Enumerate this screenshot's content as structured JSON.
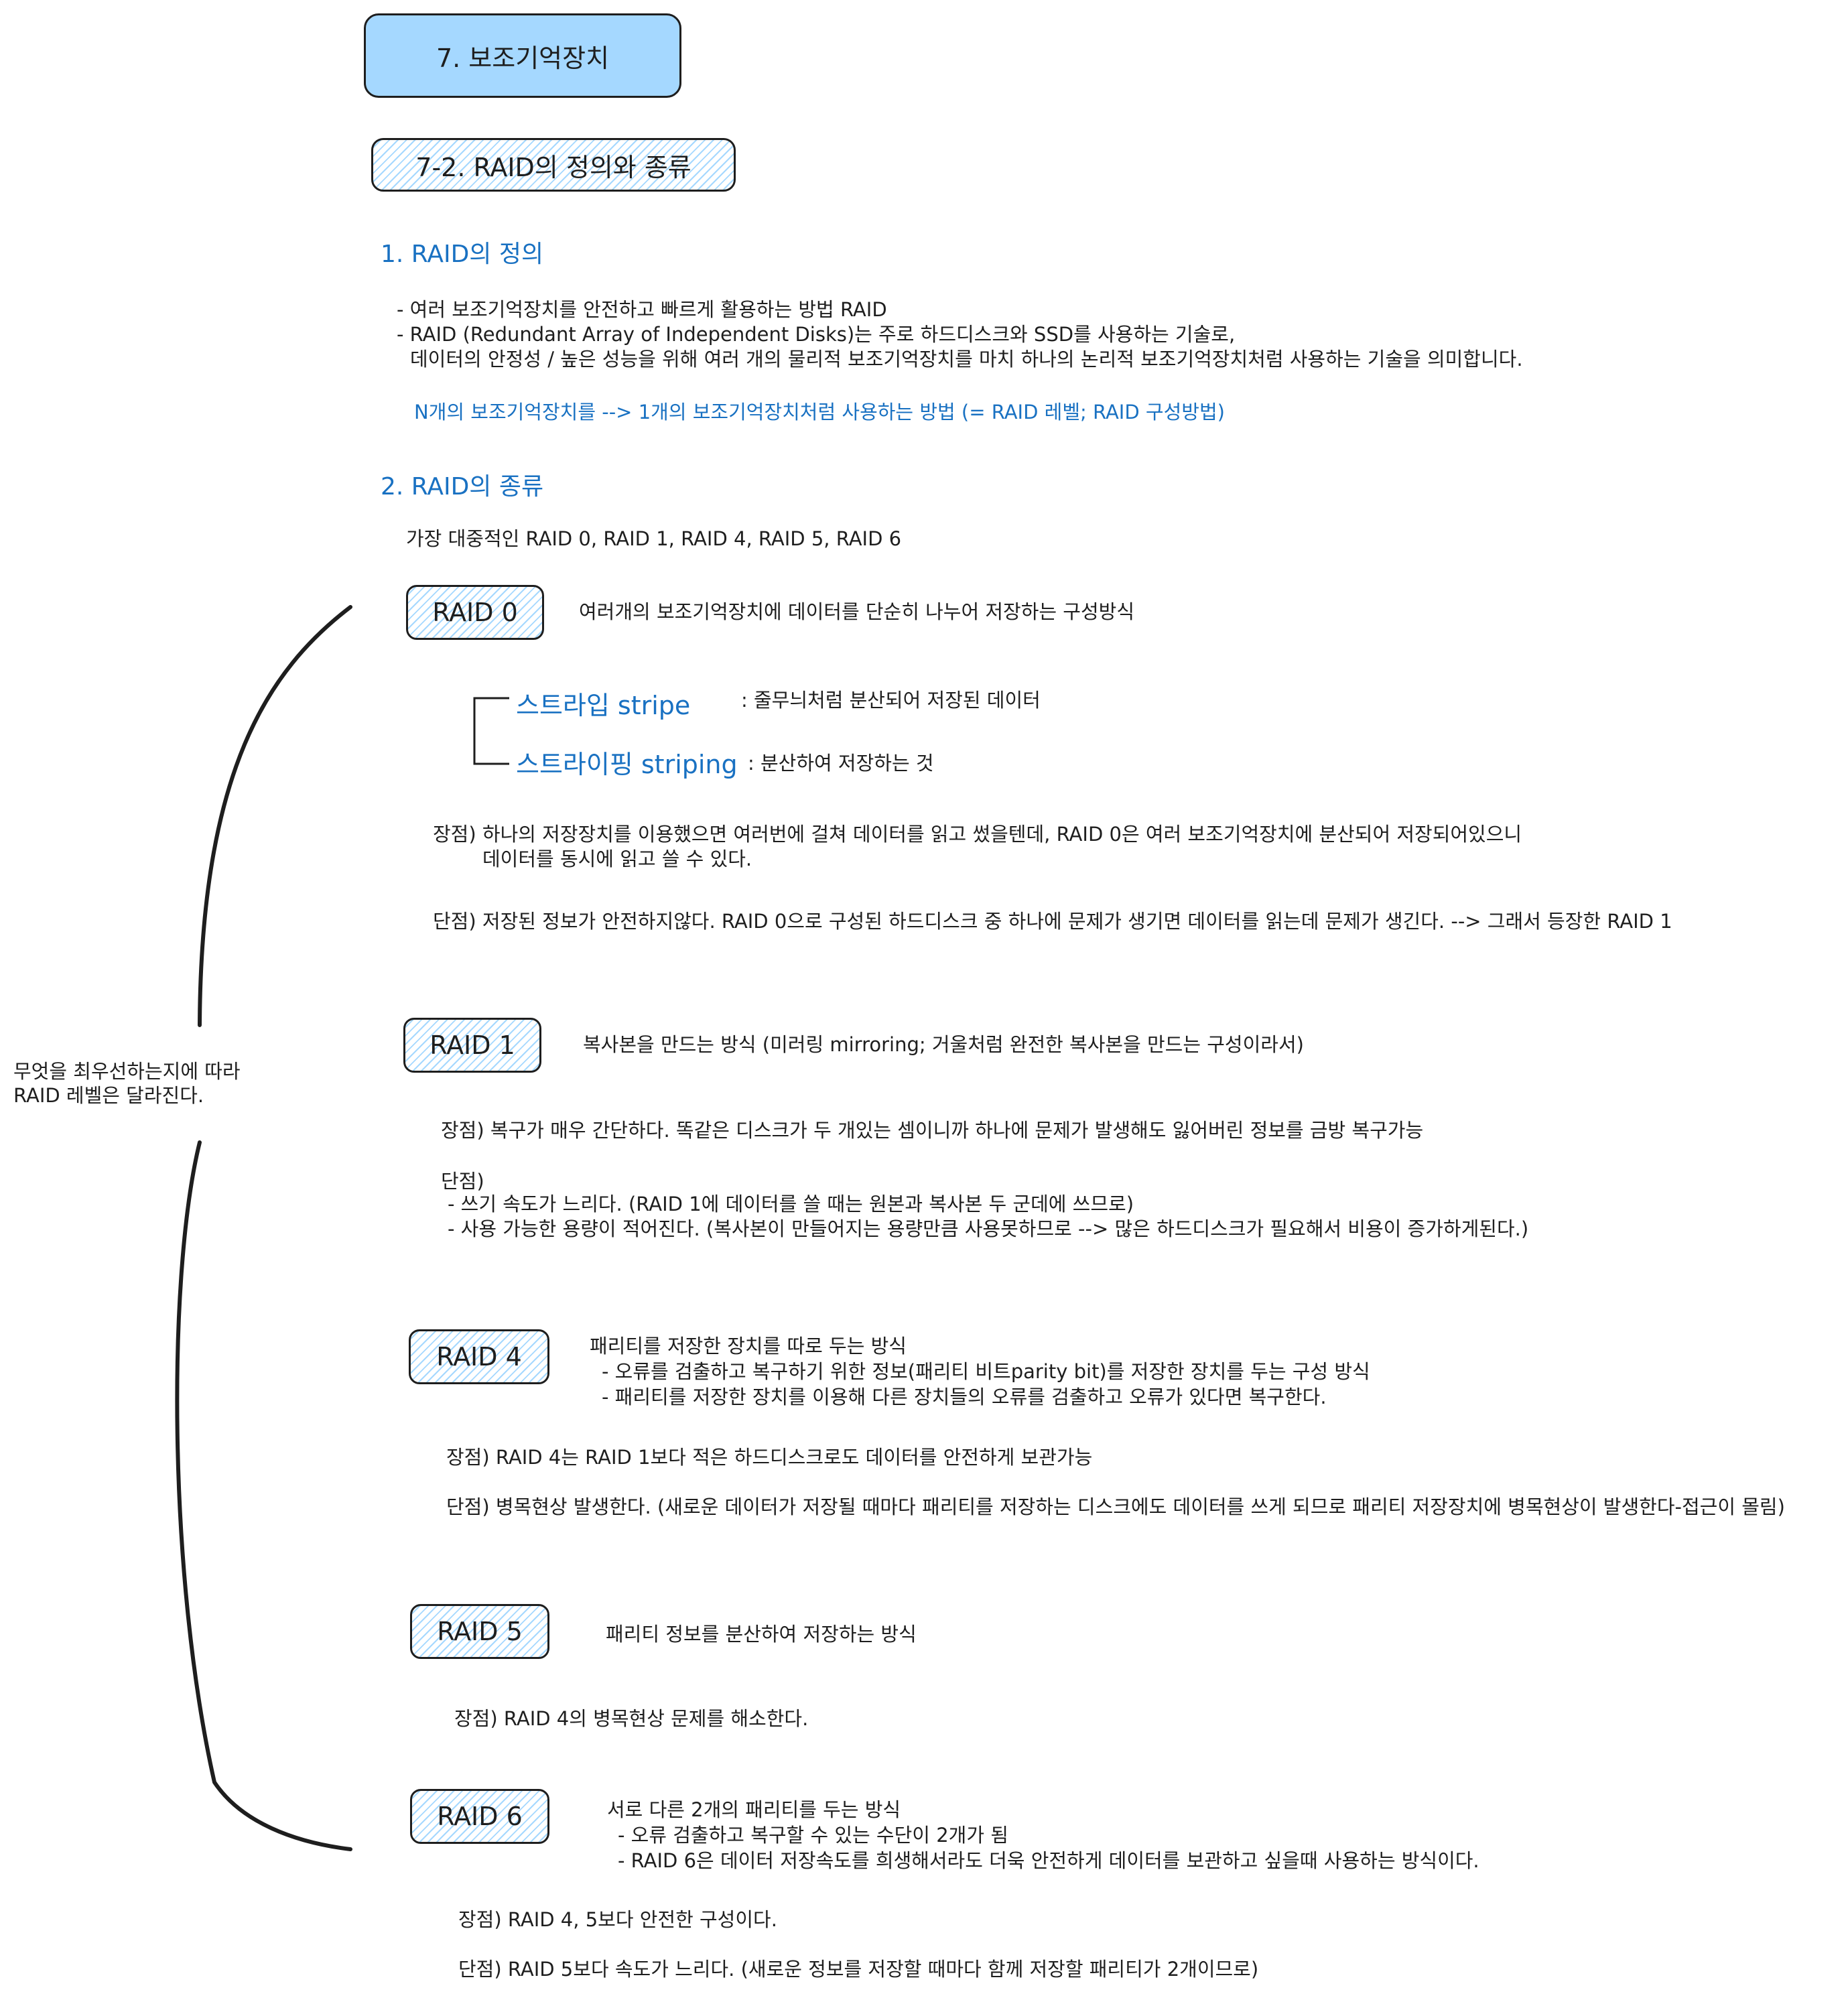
{
  "title": "7. 보조기억장치",
  "subtitle": "7-2. RAID의 정의와 종류",
  "section1": {
    "heading": "1. RAID의 정의",
    "lines": [
      "- 여러 보조기억장치를 안전하고 빠르게 활용하는 방법 RAID",
      "- RAID (Redundant Array of Independent Disks)는 주로 하드디스크와 SSD를 사용하는 기술로,",
      "데이터의 안정성 / 높은 성능을 위해 여러 개의 물리적 보조기억장치를 마치 하나의 논리적 보조기억장치처럼 사용하는 기술을 의미합니다."
    ],
    "summary": "N개의 보조기억장치를 --> 1개의 보조기억장치처럼 사용하는 방법  (= RAID 레벨; RAID 구성방법)"
  },
  "section2": {
    "heading": "2. RAID의 종류",
    "intro": "가장 대중적인 RAID 0, RAID 1, RAID 4, RAID 5, RAID 6"
  },
  "side_note": [
    "무엇을 최우선하는지에 따라",
    "RAID 레벨은 달라진다."
  ],
  "raid0": {
    "label": "RAID 0",
    "desc": "여러개의 보조기억장치에 데이터를 단순히 나누어 저장하는 구성방식",
    "stripe": "스트라입 stripe",
    "stripe_desc": ": 줄무늬처럼 분산되어 저장된 데이터",
    "striping": "스트라이핑 striping",
    "striping_desc": ": 분산하여 저장하는 것",
    "pro1": "장점) 하나의 저장장치를 이용했으면 여러번에 걸쳐 데이터를 읽고 썼을텐데, RAID 0은 여러 보조기억장치에 분산되어 저장되어있으니",
    "pro2": "데이터를 동시에 읽고 쓸 수 있다.",
    "con": "단점) 저장된 정보가 안전하지않다. RAID 0으로 구성된 하드디스크 중 하나에 문제가 생기면 데이터를 읽는데 문제가 생긴다. --> 그래서 등장한 RAID 1"
  },
  "raid1": {
    "label": "RAID 1",
    "desc": "복사본을 만드는 방식 (미러링 mirroring; 거울처럼 완전한 복사본을 만드는 구성이라서)",
    "pro": "장점) 복구가 매우 간단하다. 똑같은 디스크가 두 개있는 셈이니까 하나에 문제가 발생해도 잃어버린 정보를 금방 복구가능",
    "con_title": "단점)",
    "con1": "- 쓰기 속도가 느리다. (RAID 1에 데이터를 쓸 때는 원본과 복사본 두 군데에 쓰므로)",
    "con2": "- 사용 가능한 용량이 적어진다. (복사본이 만들어지는 용량만큼 사용못하므로 --> 많은 하드디스크가 필요해서 비용이 증가하게된다.)"
  },
  "raid4": {
    "label": "RAID 4",
    "desc": "패리티를 저장한 장치를 따로 두는 방식",
    "desc1": "- 오류를 검출하고 복구하기 위한 정보(패리티 비트parity bit)를 저장한 장치를 두는 구성 방식",
    "desc2": "- 패리티를 저장한 장치를 이용해 다른 장치들의 오류를 검출하고 오류가 있다면 복구한다.",
    "pro": "장점) RAID 4는 RAID 1보다 적은 하드디스크로도 데이터를 안전하게 보관가능",
    "con": "단점) 병목현상 발생한다. (새로운 데이터가 저장될 때마다 패리티를 저장하는 디스크에도 데이터를 쓰게 되므로 패리티 저장장치에 병목현상이 발생한다-접근이 몰림)"
  },
  "raid5": {
    "label": "RAID 5",
    "desc": "패리티 정보를 분산하여 저장하는 방식",
    "pro": "장점) RAID 4의 병목현상 문제를 해소한다."
  },
  "raid6": {
    "label": "RAID 6",
    "desc": "서로 다른 2개의 패리티를 두는 방식",
    "desc1": "- 오류 검출하고 복구할 수 있는 수단이 2개가 됨",
    "desc2": "- RAID 6은 데이터 저장속도를 희생해서라도 더욱 안전하게 데이터를 보관하고 싶을때 사용하는 방식이다.",
    "pro": "장점) RAID 4, 5보다 안전한 구성이다.",
    "con": "단점) RAID 5보다 속도가 느리다. (새로운 정보를 저장할 때마다 함께 저장할 패리티가 2개이므로)"
  },
  "colors": {
    "accent_blue": "#1971c2",
    "title_fill": "#a5d8ff",
    "hatch": "#a5d8ff",
    "ink": "#1e1e1e"
  }
}
